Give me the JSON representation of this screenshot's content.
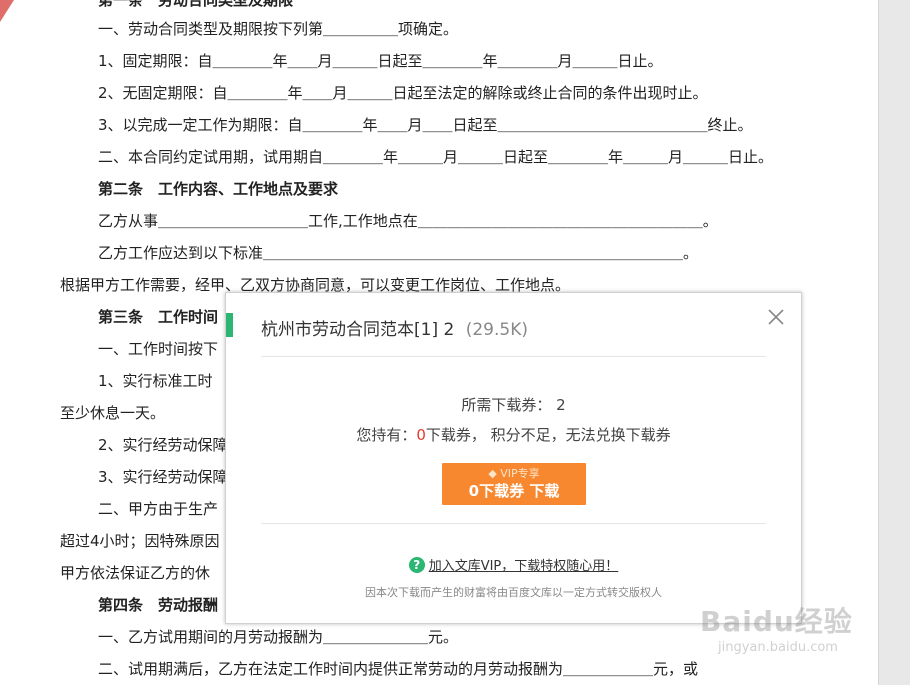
{
  "doc": {
    "lines": [
      {
        "text": "第一条　劳动合同类型及期限",
        "bold": true
      },
      {
        "text": "一、劳动合同类型及期限按下列第＿＿＿＿＿项确定。",
        "bold": false
      },
      {
        "text": "1、固定期限：自＿＿＿＿年＿＿月＿＿＿日起至＿＿＿＿年＿＿＿＿月＿＿＿日止。",
        "bold": false
      },
      {
        "text": "2、无固定期限：自＿＿＿＿年＿＿月＿＿＿日起至法定的解除或终止合同的条件出现时止。",
        "bold": false
      },
      {
        "text": "3、以完成一定工作为期限：自＿＿＿＿年＿＿月＿＿日起至＿＿＿＿＿＿＿＿＿＿＿＿＿＿终止。",
        "bold": false
      },
      {
        "text": "二、本合同约定试用期，试用期自＿＿＿＿年＿＿＿月＿＿＿日起至＿＿＿＿年＿＿＿月＿＿＿日止。",
        "bold": false
      },
      {
        "text": "第二条　工作内容、工作地点及要求",
        "bold": true
      },
      {
        "text": "乙方从事＿＿＿＿＿＿＿＿＿＿工作,工作地点在＿＿＿＿＿＿＿＿＿＿＿＿＿＿＿＿＿＿＿。",
        "bold": false
      },
      {
        "text": "乙方工作应达到以下标准＿＿＿＿＿＿＿＿＿＿＿＿＿＿＿＿＿＿＿＿＿＿＿＿＿＿＿＿。",
        "bold": false
      },
      {
        "text": "根据甲方工作需要，经甲、乙双方协商同意，可以变更工作岗位、工作地点。",
        "bold": false
      },
      {
        "text": "第三条　工作时间",
        "bold": true
      },
      {
        "text": "一、工作时间按下",
        "bold": false
      },
      {
        "text": "1、实行标准工时",
        "bold": false
      },
      {
        "text": "至少休息一天。",
        "bold": false
      },
      {
        "text": "2、实行经劳动保障",
        "bold": false
      },
      {
        "text": "3、实行经劳动保障",
        "bold": false
      },
      {
        "text": "二、甲方由于生产",
        "bold": false
      },
      {
        "text": "超过4小时；因特殊原因",
        "bold": false
      },
      {
        "text": "甲方依法保证乙方的休",
        "bold": false
      },
      {
        "text": "第四条　劳动报酬",
        "bold": true
      },
      {
        "text": "一、乙方试用期间的月劳动报酬为＿＿＿＿＿＿＿元。",
        "bold": false
      },
      {
        "text": "二、试用期满后，乙方在法定工作时间内提供正常劳动的月劳动报酬为＿＿＿＿＿＿元，或",
        "bold": false
      }
    ]
  },
  "dialog": {
    "title": "杭州市劳动合同范本[1] 2",
    "size": "(29.5K)",
    "need_label": "所需下载券：",
    "need_value": "2",
    "have_prefix": "您持有：",
    "have_value": "0",
    "have_suffix": "下载券，  积分不足，无法兑换下载券",
    "button_vip": "VIP专享",
    "button_main": "0下载券 下载",
    "join_link": "加入文库VIP，下载特权随心用！",
    "notice": "因本次下载而产生的财富将由百度文库以一定方式转交版权人",
    "accent_color": "#2bb673",
    "button_color": "#f7882f",
    "close_icon": "close-icon"
  },
  "watermark": {
    "brand": "Baidu经验",
    "url": "jingyan.baidu.com"
  }
}
